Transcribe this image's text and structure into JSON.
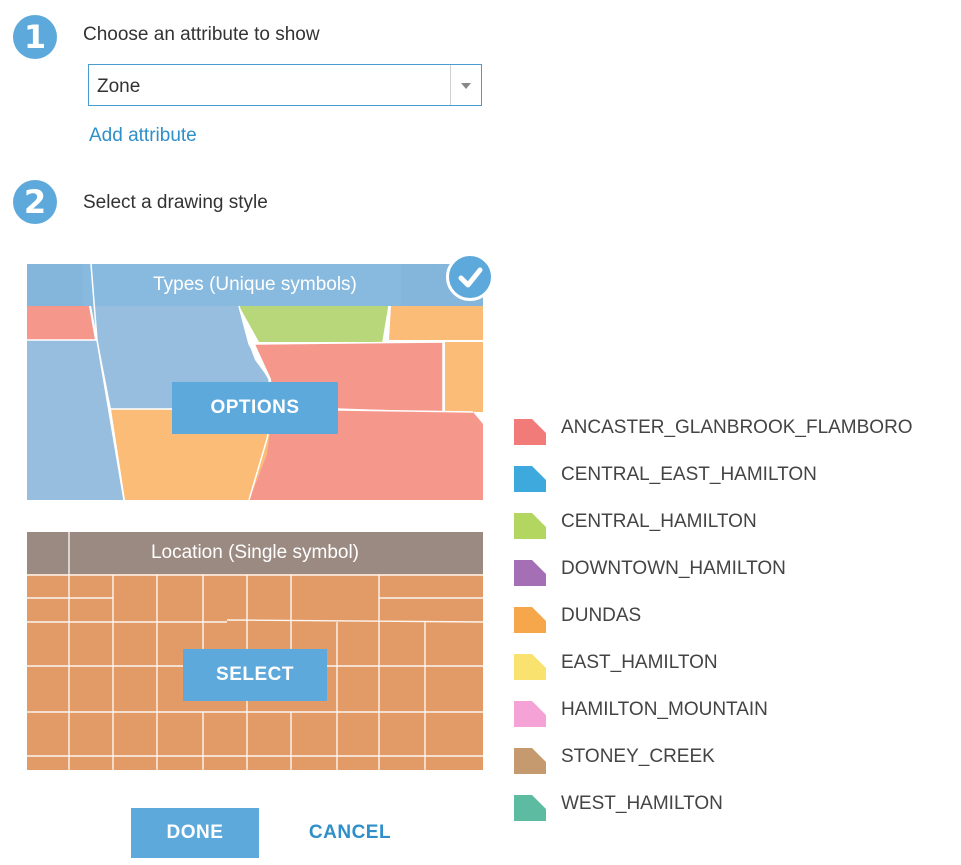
{
  "step1": {
    "number": "1",
    "title": "Choose an attribute to show"
  },
  "attribute_select": {
    "value": "Zone"
  },
  "add_attribute_link": "Add attribute",
  "step2": {
    "number": "2",
    "title": "Select a drawing style"
  },
  "styles": [
    {
      "title": "Types (Unique symbols)",
      "button": "OPTIONS",
      "selected": true
    },
    {
      "title": "Location (Single symbol)",
      "button": "SELECT",
      "selected": false
    }
  ],
  "legend": [
    {
      "label": "ANCASTER_GLANBROOK_FLAMBORO",
      "color": "#f07b78"
    },
    {
      "label": "CENTRAL_EAST_HAMILTON",
      "color": "#3ea9dc"
    },
    {
      "label": "CENTRAL_HAMILTON",
      "color": "#b2d660"
    },
    {
      "label": "DOWNTOWN_HAMILTON",
      "color": "#a46fb5"
    },
    {
      "label": "DUNDAS",
      "color": "#f6a74b"
    },
    {
      "label": "EAST_HAMILTON",
      "color": "#f9e26e"
    },
    {
      "label": "HAMILTON_MOUNTAIN",
      "color": "#f5a3d6"
    },
    {
      "label": "STONEY_CREEK",
      "color": "#c49a6e"
    },
    {
      "label": "WEST_HAMILTON",
      "color": "#5cbba1"
    }
  ],
  "buttons": {
    "done": "DONE",
    "cancel": "CANCEL"
  },
  "colors": {
    "accent": "#5ea9db",
    "link": "#2f8fc9",
    "location_fill": "#e29a66",
    "location_header": "#9b8a82"
  },
  "icons": {
    "step": "step-number-badge",
    "check": "check-circle-icon",
    "dropdown": "chevron-down-icon"
  }
}
